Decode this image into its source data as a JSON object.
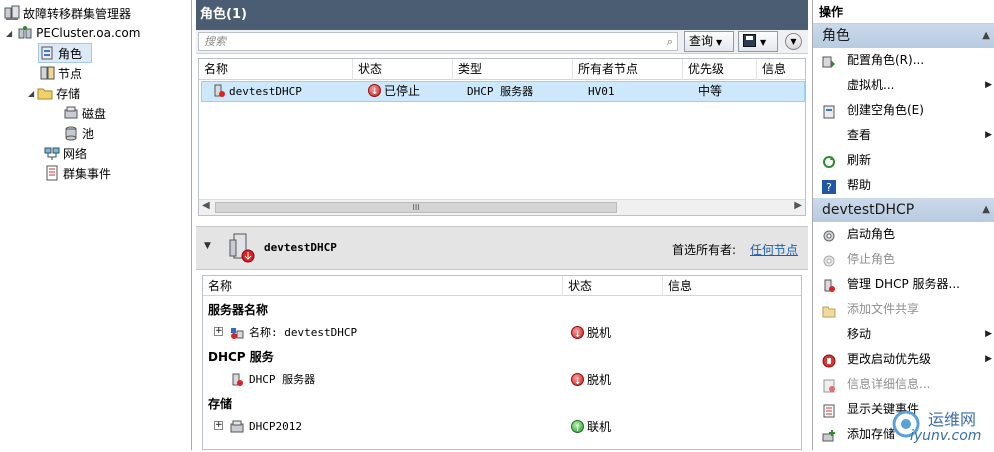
{
  "tree": {
    "root": "故障转移群集管理器",
    "cluster": "PECluster.oa.com",
    "items": [
      "角色",
      "节点",
      "存储",
      "磁盘",
      "池",
      "网络",
      "群集事件"
    ]
  },
  "center": {
    "title": "角色(1)",
    "search_placeholder": "搜索",
    "query_label": "查询",
    "columns": [
      "名称",
      "状态",
      "类型",
      "所有者节点",
      "优先级",
      "信息"
    ],
    "row": {
      "name": "devtestDHCP",
      "status": "已停止",
      "type": "DHCP 服务器",
      "owner": "HV01",
      "priority": "中等",
      "info": ""
    },
    "scroll_grip": "III"
  },
  "detail": {
    "name": "devtestDHCP",
    "preferred_label": "首选所有者:",
    "preferred_link": "任何节点",
    "columns": [
      "名称",
      "状态",
      "信息"
    ],
    "sections": [
      {
        "title": "服务器名称",
        "item": "名称: devtestDHCP",
        "status": "脱机",
        "kind": "stop"
      },
      {
        "title": "DHCP 服务",
        "item": "DHCP 服务器",
        "status": "脱机",
        "kind": "stop"
      },
      {
        "title": "存储",
        "item": "DHCP2012",
        "status": "联机",
        "kind": "go"
      }
    ]
  },
  "actions": {
    "title": "操作",
    "group1": "角色",
    "group1_items": [
      {
        "label": "配置角色(R)...",
        "icon": "configure-icon",
        "arrow": false,
        "disabled": false
      },
      {
        "label": "虚拟机...",
        "icon": "",
        "arrow": true,
        "disabled": false
      },
      {
        "label": "创建空角色(E)",
        "icon": "create-role-icon",
        "arrow": false,
        "disabled": false
      },
      {
        "label": "查看",
        "icon": "",
        "arrow": true,
        "disabled": false
      },
      {
        "label": "刷新",
        "icon": "refresh-icon",
        "arrow": false,
        "disabled": false
      },
      {
        "label": "帮助",
        "icon": "help-icon",
        "arrow": false,
        "disabled": false
      }
    ],
    "group2": "devtestDHCP",
    "group2_items": [
      {
        "label": "启动角色",
        "icon": "start-icon",
        "arrow": false,
        "disabled": false
      },
      {
        "label": "停止角色",
        "icon": "stop-icon",
        "arrow": false,
        "disabled": true
      },
      {
        "label": "管理 DHCP 服务器...",
        "icon": "manage-icon",
        "arrow": false,
        "disabled": false
      },
      {
        "label": "添加文件共享",
        "icon": "share-icon",
        "arrow": false,
        "disabled": true
      },
      {
        "label": "移动",
        "icon": "",
        "arrow": true,
        "disabled": false
      },
      {
        "label": "更改启动优先级",
        "icon": "priority-icon",
        "arrow": true,
        "disabled": false
      },
      {
        "label": "信息详细信息...",
        "icon": "info-icon",
        "arrow": false,
        "disabled": true
      },
      {
        "label": "显示关键事件",
        "icon": "events-icon",
        "arrow": false,
        "disabled": false
      },
      {
        "label": "添加存储",
        "icon": "add-storage-icon",
        "arrow": false,
        "disabled": false
      }
    ]
  },
  "watermark": {
    "cn": "运维网",
    "url": "iyunv.com"
  },
  "colors": {
    "titlebar": "#4a5d73",
    "selection": "#cde8fb",
    "group_header": "#c3d4e8",
    "link": "#1a5fb4"
  }
}
